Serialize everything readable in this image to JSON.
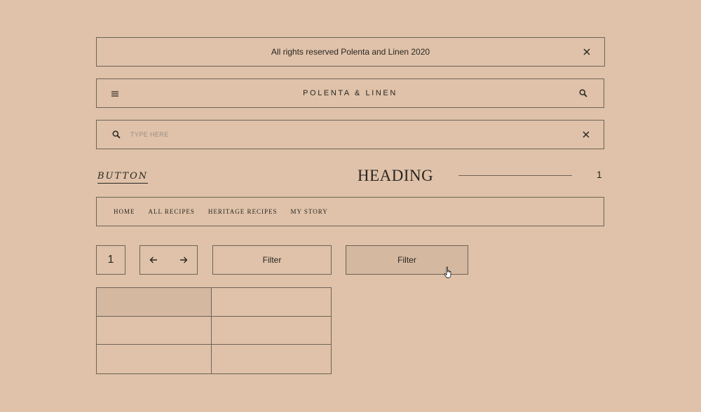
{
  "notice": {
    "text": "All rights reserved Polenta and Linen 2020",
    "close_icon": "close-icon"
  },
  "topbar": {
    "title": "POLENTA & LINEN",
    "menu_icon": "hamburger-menu-icon",
    "search_icon": "search-icon"
  },
  "searchbar": {
    "placeholder": "TYPE HERE",
    "value": "",
    "search_icon": "search-icon",
    "clear_icon": "close-icon"
  },
  "header_row": {
    "button_label": "BUTTON",
    "heading": "HEADING",
    "number": "1"
  },
  "nav": {
    "items": [
      "HOME",
      "ALL RECIPES",
      "HERITAGE RECIPES",
      "MY STORY"
    ]
  },
  "controls": {
    "page_number": "1",
    "prev_icon": "arrow-left-icon",
    "next_icon": "arrow-right-icon",
    "filter_label": "Filter",
    "filter_hover_label": "Filter"
  },
  "grid": {
    "rows": 3,
    "cols": 2,
    "cells": [
      "",
      "",
      "",
      "",
      "",
      ""
    ],
    "active_cell": 0
  },
  "colors": {
    "background": "#dfc2a9",
    "border": "#6e6358",
    "text": "#2a2622",
    "hover_fill": "#d4b8a0"
  }
}
